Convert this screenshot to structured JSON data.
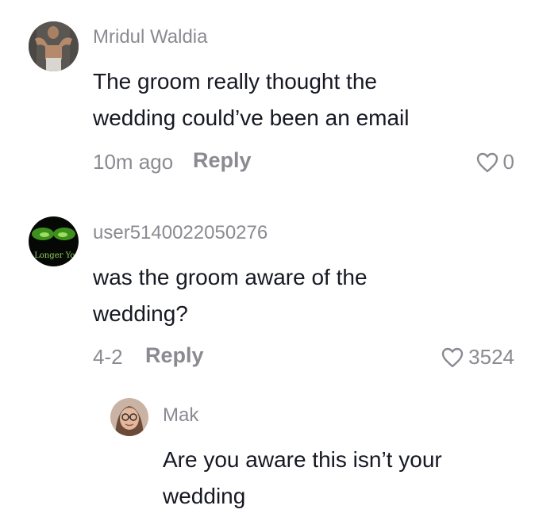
{
  "comments": [
    {
      "username": "Mridul Waldia",
      "text_lines": [
        "The groom really thought the",
        "wedding could’ve been an email"
      ],
      "time": "10m ago",
      "reply_label": "Reply",
      "likes": "0",
      "avatar": "avatar-photo-shirtless-man"
    },
    {
      "username": "user5140022050276",
      "text_lines": [
        "was the groom aware of the",
        "wedding?"
      ],
      "time": "4-2",
      "reply_label": "Reply",
      "likes": "3524",
      "avatar_text": "o Longer Yo"
    }
  ],
  "reply": {
    "username": "Mak",
    "text_lines": [
      "Are you aware this isn’t your",
      "wedding"
    ],
    "avatar": "avatar-photo-woman-glasses"
  },
  "colors": {
    "primary_text": "#161823",
    "secondary_text": "#8a8b91"
  },
  "icons": {
    "like": "heart-outline-icon"
  }
}
